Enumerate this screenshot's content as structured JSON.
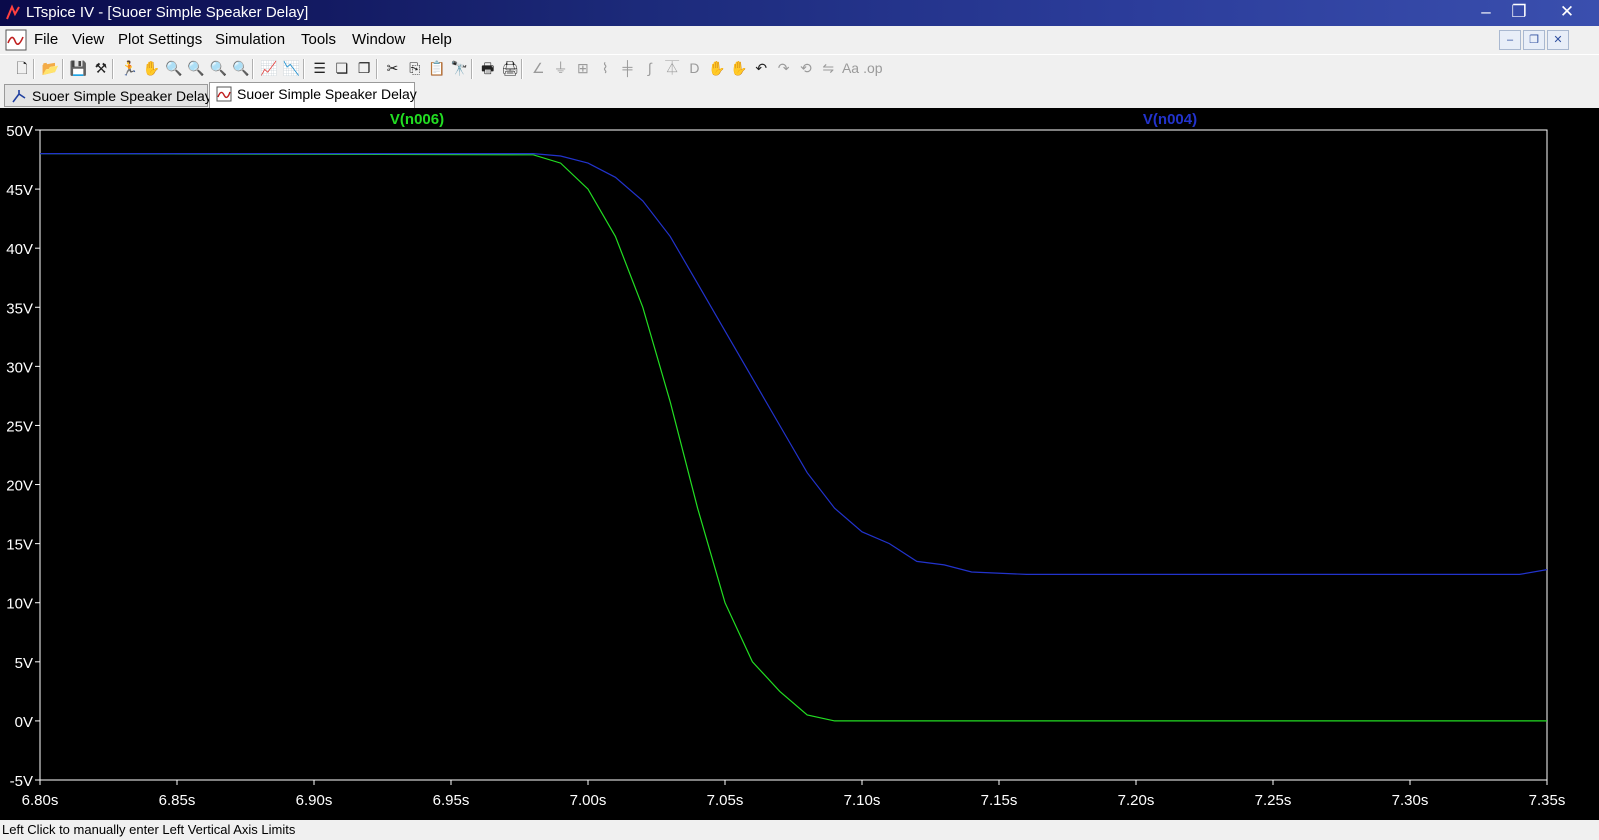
{
  "window": {
    "title": "LTspice IV - [Suoer Simple Speaker Delay]",
    "controls": {
      "minimize": "–",
      "maximize": "❐",
      "close": "✕"
    }
  },
  "menu": {
    "items": [
      "File",
      "View",
      "Plot Settings",
      "Simulation",
      "Tools",
      "Window",
      "Help"
    ],
    "mdi_controls": {
      "minimize": "–",
      "restore": "❐",
      "close": "✕"
    }
  },
  "toolbar": {
    "icons": [
      {
        "name": "new-schematic-icon",
        "glyph": "🗋",
        "enabled": true
      },
      {
        "name": "open-icon",
        "glyph": "📂",
        "enabled": true
      },
      {
        "name": "save-icon",
        "glyph": "💾",
        "enabled": true
      },
      {
        "name": "control-panel-icon",
        "glyph": "⚒",
        "enabled": true
      },
      {
        "name": "run-icon",
        "glyph": "🏃",
        "enabled": true
      },
      {
        "name": "pan-icon",
        "glyph": "✋",
        "enabled": true
      },
      {
        "name": "zoom-in-icon",
        "glyph": "🔍",
        "enabled": true
      },
      {
        "name": "zoom-area-icon",
        "glyph": "🔍",
        "enabled": true
      },
      {
        "name": "zoom-out-icon",
        "glyph": "🔍",
        "enabled": true
      },
      {
        "name": "zoom-cancel-icon",
        "glyph": "🔍",
        "enabled": true
      },
      {
        "name": "autorange-icon",
        "glyph": "📈",
        "enabled": true
      },
      {
        "name": "add-trace-icon",
        "glyph": "📉",
        "enabled": true
      },
      {
        "name": "tile-horizontal-icon",
        "glyph": "☰",
        "enabled": true
      },
      {
        "name": "cascade-icon",
        "glyph": "❏",
        "enabled": true
      },
      {
        "name": "tile-vertical-icon",
        "glyph": "❐",
        "enabled": true
      },
      {
        "name": "cut-icon",
        "glyph": "✂",
        "enabled": true
      },
      {
        "name": "copy-icon",
        "glyph": "⎘",
        "enabled": true
      },
      {
        "name": "paste-icon",
        "glyph": "📋",
        "enabled": true
      },
      {
        "name": "find-icon",
        "glyph": "🔭",
        "enabled": true
      },
      {
        "name": "print-preview-icon",
        "glyph": "🖶",
        "enabled": true
      },
      {
        "name": "print-icon",
        "glyph": "🖨",
        "enabled": true
      },
      {
        "name": "wire-icon",
        "glyph": "∠",
        "enabled": false
      },
      {
        "name": "ground-icon",
        "glyph": "⏚",
        "enabled": false
      },
      {
        "name": "label-net-icon",
        "glyph": "⊞",
        "enabled": false
      },
      {
        "name": "resistor-icon",
        "glyph": "⌇",
        "enabled": false
      },
      {
        "name": "capacitor-icon",
        "glyph": "╪",
        "enabled": false
      },
      {
        "name": "inductor-icon",
        "glyph": "∫",
        "enabled": false
      },
      {
        "name": "diode-icon",
        "glyph": "⏄",
        "enabled": false
      },
      {
        "name": "component-icon",
        "glyph": "D",
        "enabled": false
      },
      {
        "name": "move-icon",
        "glyph": "✋",
        "enabled": false
      },
      {
        "name": "drag-icon",
        "glyph": "✋",
        "enabled": false
      },
      {
        "name": "undo-icon",
        "glyph": "↶",
        "enabled": true
      },
      {
        "name": "redo-icon",
        "glyph": "↷",
        "enabled": false
      },
      {
        "name": "rotate-icon",
        "glyph": "⟲",
        "enabled": false
      },
      {
        "name": "mirror-icon",
        "glyph": "⇋",
        "enabled": false
      },
      {
        "name": "text-icon",
        "glyph": "Aa",
        "enabled": false
      },
      {
        "name": "spice-directive-icon",
        "glyph": ".op",
        "enabled": false
      }
    ]
  },
  "tabs": [
    {
      "label": "Suoer Simple Speaker Delay",
      "kind": "schematic",
      "active": false
    },
    {
      "label": "Suoer Simple Speaker Delay",
      "kind": "waveform",
      "active": true
    }
  ],
  "status": {
    "text": "Left Click to manually enter Left Vertical Axis Limits"
  },
  "chart_data": {
    "type": "line",
    "title": "",
    "xlabel": "",
    "ylabel": "",
    "xlim": [
      6.8,
      7.35
    ],
    "ylim": [
      -5,
      50
    ],
    "x_ticks": [
      "6.80s",
      "6.85s",
      "6.90s",
      "6.95s",
      "7.00s",
      "7.05s",
      "7.10s",
      "7.15s",
      "7.20s",
      "7.25s",
      "7.30s",
      "7.35s"
    ],
    "y_ticks": [
      "50V",
      "45V",
      "40V",
      "35V",
      "30V",
      "25V",
      "20V",
      "15V",
      "10V",
      "5V",
      "0V",
      "-5V"
    ],
    "grid": false,
    "background": "#000000",
    "series": [
      {
        "name": "V(n006)",
        "color": "#22dd22",
        "x": [
          6.8,
          6.98,
          6.99,
          7.0,
          7.01,
          7.02,
          7.03,
          7.04,
          7.05,
          7.06,
          7.07,
          7.08,
          7.09,
          7.1,
          7.114,
          7.18,
          7.35
        ],
        "y": [
          48,
          47.9,
          47.2,
          45,
          41,
          35,
          27,
          18,
          10,
          5,
          2.5,
          0.5,
          0,
          0,
          0,
          0,
          0
        ]
      },
      {
        "name": "V(n004)",
        "color": "#2233cc",
        "x": [
          6.8,
          6.98,
          6.99,
          7.0,
          7.01,
          7.02,
          7.03,
          7.04,
          7.05,
          7.06,
          7.07,
          7.08,
          7.09,
          7.1,
          7.11,
          7.12,
          7.13,
          7.14,
          7.16,
          7.18,
          7.2,
          7.22,
          7.24,
          7.26,
          7.28,
          7.3,
          7.32,
          7.34,
          7.35
        ],
        "y": [
          48,
          48,
          47.8,
          47.2,
          46,
          44,
          41,
          37,
          33,
          29,
          25,
          21,
          18,
          16,
          15,
          13.5,
          13.2,
          12.6,
          12.4,
          12.4,
          12.4,
          12.4,
          12.4,
          12.4,
          12.4,
          12.4,
          12.4,
          12.4,
          12.8
        ]
      }
    ]
  }
}
